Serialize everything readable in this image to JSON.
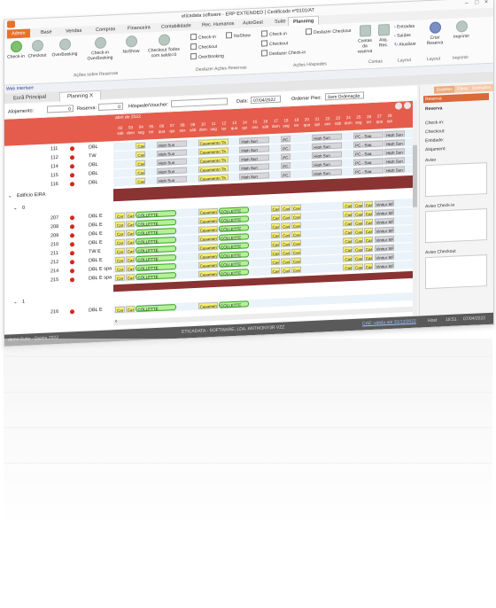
{
  "window": {
    "title": "eticadata software - ERP EXTENDED | Certificado nº0101/AT",
    "controls": [
      "–",
      "□",
      "×"
    ]
  },
  "ribbon_tabs": [
    "Admin",
    "Base",
    "Vendas",
    "Compras",
    "Financeira",
    "Contabilidade",
    "Rec. Humanos",
    "AutoGest",
    "Suite",
    "Planning"
  ],
  "ribbon": {
    "buttons": {
      "checkin": "Check-in",
      "checkout": "Checkout",
      "overbooking": "OverBooking",
      "checkin_overbooking": "Check-in OverBooking",
      "noshow": "NoShow",
      "checkout_todos": "Checkout Todos com saldo=0",
      "contas_reserva": "Contas da reserva",
      "alojamento_res": "Aloj. Res.",
      "criar_reserva": "Criar Reserva",
      "imprimir": "Imprimir"
    },
    "group1_label": "Ações sobre Reservas",
    "col2": [
      "Check-in",
      "NoShow",
      "Checkout",
      "OverBooking"
    ],
    "col2_label": "Desfazer Ações Reservas",
    "col3": [
      "Check-in",
      "Desfazer Checkout",
      "Checkout",
      "Desfazer Check-in"
    ],
    "col3_label": "Ações Hóspedes",
    "layout_items": [
      "Entradas",
      "Saídas",
      "Atualizar"
    ],
    "labels": {
      "contas": "Contas",
      "layout": "Layout",
      "layout2": "Layout",
      "imprimir": "Imprimir"
    }
  },
  "web_interface": "Web Interface",
  "doc_tabs": [
    "Ecrã Principal",
    "Planning  X"
  ],
  "filters": {
    "alojamento_label": "Alojamento:",
    "alojamento_value": "0",
    "reserva_label": "Reserva:",
    "reserva_value": "0",
    "hospede_label": "Hóspede/Voucher:",
    "hospede_value": "",
    "data_label": "Data:",
    "data_value": "07/04/2022",
    "ordenar_label": "Ordenar Piso:",
    "ordenar_value": "Sem Ordenação"
  },
  "grid": {
    "month": "abril de 2022",
    "days": [
      {
        "d": "02",
        "w": "sáb"
      },
      {
        "d": "03",
        "w": "dom"
      },
      {
        "d": "04",
        "w": "seg"
      },
      {
        "d": "05",
        "w": "ter"
      },
      {
        "d": "06",
        "w": "qua"
      },
      {
        "d": "07",
        "w": "qui"
      },
      {
        "d": "08",
        "w": "sex"
      },
      {
        "d": "09",
        "w": "sáb"
      },
      {
        "d": "10",
        "w": "dom"
      },
      {
        "d": "11",
        "w": "seg"
      },
      {
        "d": "12",
        "w": "ter"
      },
      {
        "d": "13",
        "w": "qua"
      },
      {
        "d": "14",
        "w": "qui"
      },
      {
        "d": "15",
        "w": "sex"
      },
      {
        "d": "16",
        "w": "sáb"
      },
      {
        "d": "17",
        "w": "dom"
      },
      {
        "d": "18",
        "w": "seg"
      },
      {
        "d": "19",
        "w": "ter"
      },
      {
        "d": "20",
        "w": "qua"
      },
      {
        "d": "21",
        "w": "qui"
      },
      {
        "d": "22",
        "w": "sex"
      },
      {
        "d": "23",
        "w": "sáb"
      },
      {
        "d": "24",
        "w": "dom"
      },
      {
        "d": "25",
        "w": "seg"
      },
      {
        "d": "26",
        "w": "ter"
      },
      {
        "d": "27",
        "w": "qua"
      },
      {
        "d": "28",
        "w": "qui"
      }
    ],
    "rows_top": [
      {
        "room": "111",
        "type": "DBL"
      },
      {
        "room": "112",
        "type": "TW"
      },
      {
        "room": "114",
        "type": "DBL"
      },
      {
        "room": "115",
        "type": "DBL"
      },
      {
        "room": "116",
        "type": "DBL"
      }
    ],
    "building_label": "Edifício EIRA",
    "floor0_label": "0",
    "rows_eira": [
      {
        "room": "207",
        "type": "DBL E"
      },
      {
        "room": "208",
        "type": "DBL E"
      },
      {
        "room": "209",
        "type": "DBL E"
      },
      {
        "room": "210",
        "type": "DBL E"
      },
      {
        "room": "211",
        "type": "TW E"
      },
      {
        "room": "212",
        "type": "DBL E"
      },
      {
        "room": "214",
        "type": "DBL E spa"
      },
      {
        "room": "215",
        "type": "DBL E spa"
      }
    ],
    "floor1_label": "1",
    "rows_floor1": [
      {
        "room": "216",
        "type": "DBL E"
      }
    ],
    "booking_texts": {
      "cas": "Cas",
      "high_sun": "High Sun",
      "casamento": "Casamento Th",
      "casamen": "Casamen",
      "pc": "PC",
      "pc_sag": "PC - Sag",
      "collette": "COLLETTE",
      "vintur": "Vinitur SF",
      "car": "Car"
    }
  },
  "right_panel": {
    "tabs": [
      "Detalhes",
      "Filtros",
      "Definições"
    ],
    "header": "Reserva",
    "reserva_label": "Reserva",
    "fields": [
      "Check-in:",
      "Checkout:",
      "Entidade:",
      "Alojament:"
    ],
    "aviso": "Aviso",
    "aviso_checkin": "Aviso Check-in",
    "aviso_checkout": "Aviso Checkout"
  },
  "statusbar": {
    "left": "demo   Suite - Quinta   2022",
    "center": "ETICADATA - SOFTWARE, LDA. ANTHONY3R VZZ",
    "right_link": "CAE: válida até 31/12/2022",
    "right_host": "Host",
    "right_time": "18:51",
    "right_date": "07/04/2022"
  }
}
